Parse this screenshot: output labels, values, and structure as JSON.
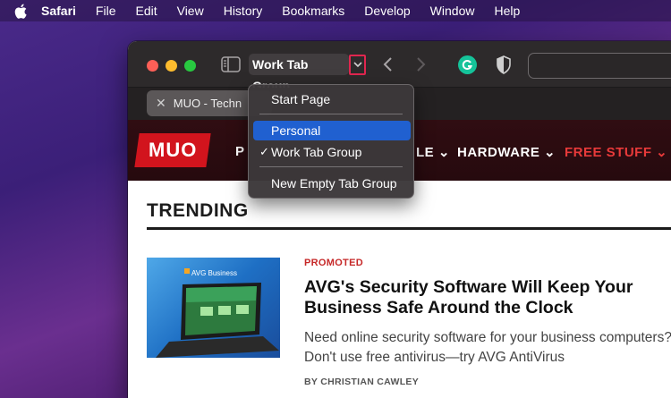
{
  "menubar": {
    "app": "Safari",
    "items": [
      "File",
      "Edit",
      "View",
      "History",
      "Bookmarks",
      "Develop",
      "Window",
      "Help"
    ]
  },
  "toolbar": {
    "tab_group_title": "Work Tab Group"
  },
  "tab": {
    "title": "MUO - Techn"
  },
  "site": {
    "logo": "MUO",
    "nav": [
      {
        "label": "P",
        "id": "p"
      },
      {
        "label": "LE ⌄",
        "id": "le"
      },
      {
        "label": "HARDWARE ⌄",
        "id": "hardware"
      },
      {
        "label": "FREE STUFF ⌄",
        "id": "freestuff"
      }
    ],
    "section_title": "TRENDING",
    "article": {
      "thumbnail_caption": "AVG Business",
      "tag": "PROMOTED",
      "headline": "AVG's Security Software Will Keep Your Business Safe Around the Clock",
      "excerpt": "Need online security software for your business computers? Don't use free antivirus—try AVG AntiVirus",
      "byline": "BY CHRISTIAN CAWLEY"
    }
  },
  "dropdown": {
    "items": [
      {
        "label": "Start Page",
        "checked": false,
        "selected": false
      },
      {
        "label": "Personal",
        "checked": false,
        "selected": true
      },
      {
        "label": "Work Tab Group",
        "checked": true,
        "selected": false
      },
      {
        "label": "New Empty Tab Group",
        "checked": false,
        "selected": false
      }
    ],
    "check_glyph": "✓"
  },
  "colors": {
    "accent": "#2060d0",
    "muo_red": "#d2141d",
    "highlight_box": "#e0264f"
  }
}
